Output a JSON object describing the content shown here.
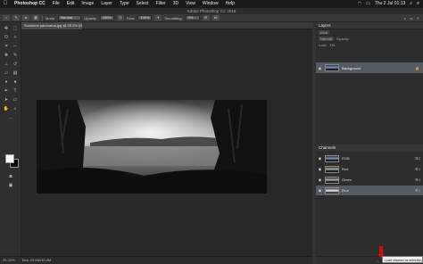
{
  "menubar": {
    "items": [
      "Photoshop CC",
      "File",
      "Edit",
      "Image",
      "Layer",
      "Type",
      "Select",
      "Filter",
      "3D",
      "View",
      "Window",
      "Help"
    ],
    "clock": "Thu 2 Jul 01:13"
  },
  "window": {
    "title": "Adobe Photoshop CC 2018"
  },
  "options": {
    "mode_label": "Mode:",
    "mode_value": "Normal",
    "opacity_label": "Opacity:",
    "opacity_value": "100%",
    "flow_label": "Flow:",
    "flow_value": "100%",
    "smoothing_label": "Smoothing:",
    "smoothing_value": "0%"
  },
  "document": {
    "tab_label": "Sunshine panorama.jpg @ 25.3% (Blue/8) *"
  },
  "status": {
    "zoom": "25.32%",
    "doc_size": "Doc: 29.5M/30.0M"
  },
  "layers_panel": {
    "tab_label": "Layers",
    "kind_label": "Kind",
    "blend_label": "Normal",
    "opacity_label": "Opacity:",
    "lock_label": "Lock:",
    "fill_label": "Fill:",
    "layer_name": "Background"
  },
  "channels_panel": {
    "tab_label": "Channels",
    "rows": [
      {
        "name": "RGB",
        "shortcut": "⌘2"
      },
      {
        "name": "Red",
        "shortcut": "⌘3"
      },
      {
        "name": "Green",
        "shortcut": "⌘4"
      },
      {
        "name": "Blue",
        "shortcut": "⌘5"
      }
    ]
  },
  "tooltip": "Load channel as selection",
  "colors": {
    "selection_highlight": "#555b63",
    "tooltip_arrow": "#d01010",
    "foreground": "#ffffff",
    "background": "#000000"
  }
}
